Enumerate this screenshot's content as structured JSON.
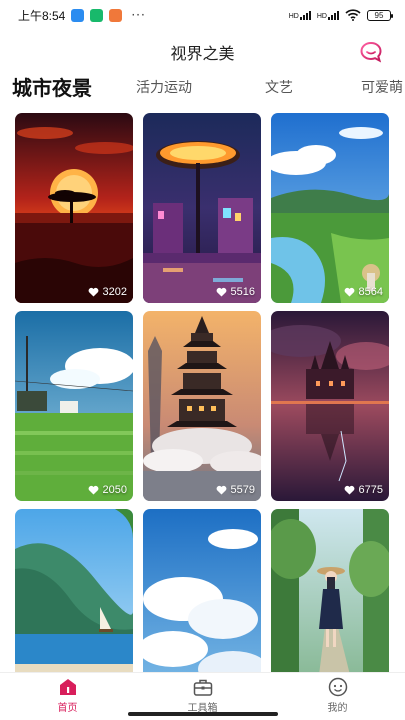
{
  "status_bar": {
    "time": "上午8:54",
    "notification_icons": [
      "message-icon",
      "wechat-icon",
      "app-icon"
    ],
    "more": "···",
    "signal_labels": [
      "HD",
      "HD"
    ],
    "wifi": "wifi-icon",
    "battery": "95"
  },
  "header": {
    "title": "视界之美",
    "chat_icon": "chat-bubble-icon"
  },
  "tabs": [
    {
      "label": "城市夜景",
      "active": true
    },
    {
      "label": "活力运动",
      "active": false
    },
    {
      "label": "文艺",
      "active": false
    },
    {
      "label": "可爱萌",
      "active": false
    }
  ],
  "wallpapers": [
    {
      "likes": "3202",
      "scene": "savanna-sunset"
    },
    {
      "likes": "5516",
      "scene": "night-street-lamp"
    },
    {
      "likes": "8564",
      "scene": "countryside-river"
    },
    {
      "likes": "2050",
      "scene": "green-field-sky"
    },
    {
      "likes": "5579",
      "scene": "floating-pagoda"
    },
    {
      "likes": "6775",
      "scene": "reflected-castle"
    },
    {
      "likes": "",
      "scene": "coast-sailboat"
    },
    {
      "likes": "",
      "scene": "cloud-sky"
    },
    {
      "likes": "",
      "scene": "forest-path-girl"
    }
  ],
  "bottom_nav": [
    {
      "label": "首页",
      "icon": "home-icon",
      "active": true
    },
    {
      "label": "工具箱",
      "icon": "toolbox-icon",
      "active": false
    },
    {
      "label": "我的",
      "icon": "profile-icon",
      "active": false
    }
  ],
  "colors": {
    "accent": "#d81e5b",
    "active_tab": "#111111",
    "inactive_tab": "#555555"
  }
}
